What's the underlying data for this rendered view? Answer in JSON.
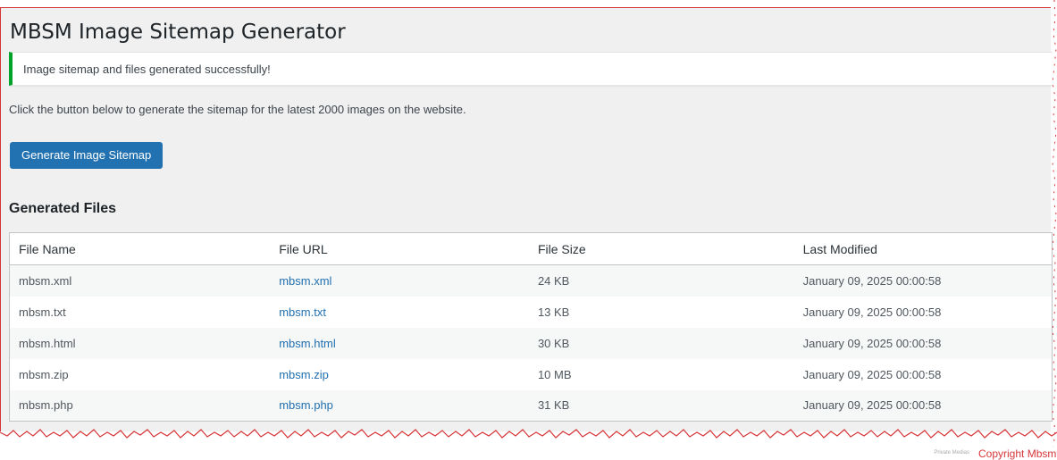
{
  "page": {
    "title": "MBSM Image Sitemap Generator",
    "notice": "Image sitemap and files generated successfully!",
    "intro": "Click the button below to generate the sitemap for the latest 2000 images on the website.",
    "generate_button": "Generate Image Sitemap",
    "section_title": "Generated Files"
  },
  "table": {
    "headers": [
      "File Name",
      "File URL",
      "File Size",
      "Last Modified"
    ],
    "rows": [
      {
        "name": "mbsm.xml",
        "url": "mbsm.xml",
        "size": "24 KB",
        "modified": "January 09, 2025 00:00:58"
      },
      {
        "name": "mbsm.txt",
        "url": "mbsm.txt",
        "size": "13 KB",
        "modified": "January 09, 2025 00:00:58"
      },
      {
        "name": "mbsm.html",
        "url": "mbsm.html",
        "size": "30 KB",
        "modified": "January 09, 2025 00:00:58"
      },
      {
        "name": "mbsm.zip",
        "url": "mbsm.zip",
        "size": "10 MB",
        "modified": "January 09, 2025 00:00:58"
      },
      {
        "name": "mbsm.php",
        "url": "mbsm.php",
        "size": "31 KB",
        "modified": "January 09, 2025 00:00:58"
      }
    ]
  },
  "footer": {
    "small_text": "Private Medias",
    "copyright": "Copyright Mbsm t"
  },
  "colors": {
    "primary_button": "#2271b1",
    "success_border": "#00a32a",
    "link": "#2271b1",
    "torn_edge": "#d63638",
    "copyright_text": "#d63638"
  }
}
